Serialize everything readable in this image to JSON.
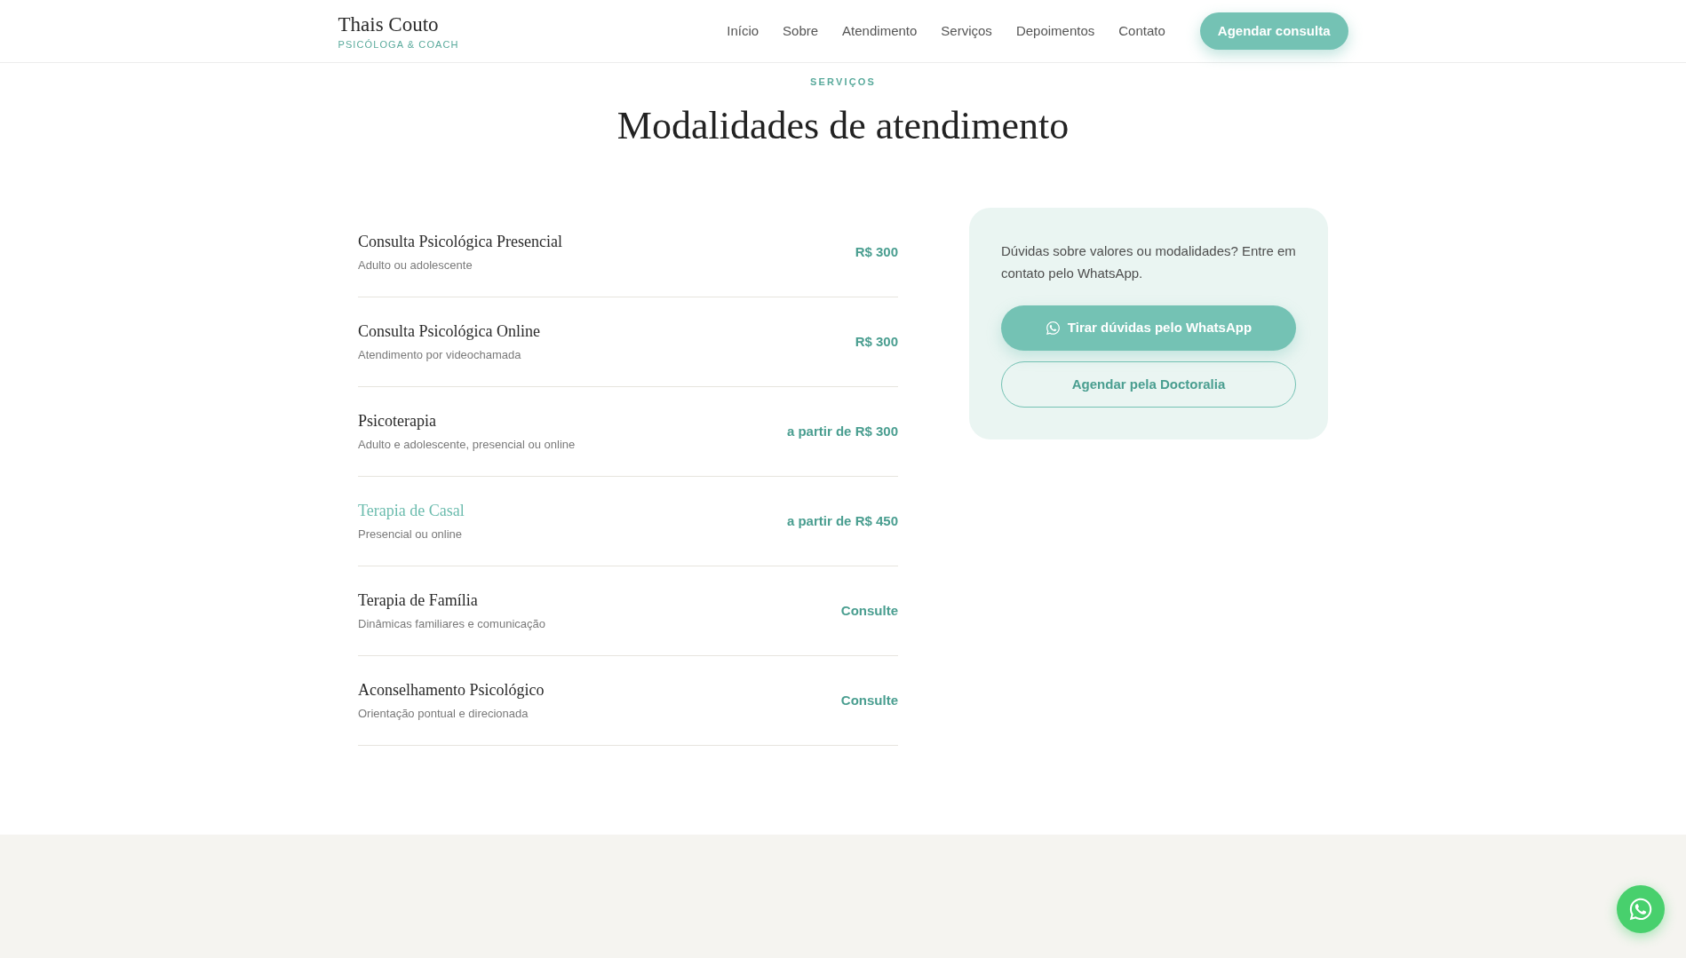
{
  "header": {
    "logo": {
      "name": "Thais Couto",
      "tagline": "PSICÓLOGA & COACH"
    },
    "nav": [
      {
        "label": "Início"
      },
      {
        "label": "Sobre"
      },
      {
        "label": "Atendimento"
      },
      {
        "label": "Serviços"
      },
      {
        "label": "Depoimentos"
      },
      {
        "label": "Contato"
      }
    ],
    "cta": "Agendar consulta"
  },
  "section": {
    "eyebrow": "SERVIÇOS",
    "title": "Modalidades de atendimento"
  },
  "services": [
    {
      "name": "Consulta Psicológica Presencial",
      "description": "Adulto ou adolescente",
      "price": "R$ 300",
      "hovered": false
    },
    {
      "name": "Consulta Psicológica Online",
      "description": "Atendimento por videochamada",
      "price": "R$ 300",
      "hovered": false
    },
    {
      "name": "Psicoterapia",
      "description": "Adulto e adolescente, presencial ou online",
      "price": "a partir de R$ 300",
      "hovered": false
    },
    {
      "name": "Terapia de Casal",
      "description": "Presencial ou online",
      "price": "a partir de R$ 450",
      "hovered": true
    },
    {
      "name": "Terapia de Família",
      "description": "Dinâmicas familiares e comunicação",
      "price": "Consulte",
      "hovered": false
    },
    {
      "name": "Aconselhamento Psicológico",
      "description": "Orientação pontual e direcionada",
      "price": "Consulte",
      "hovered": false
    }
  ],
  "contact_card": {
    "text": "Dúvidas sobre valores ou modalidades? Entre em contato pelo WhatsApp.",
    "buttons": [
      {
        "label": "Tirar dúvidas pelo WhatsApp",
        "kind": "primary"
      },
      {
        "label": "Agendar pela Doctoralia",
        "kind": "outline"
      }
    ]
  }
}
